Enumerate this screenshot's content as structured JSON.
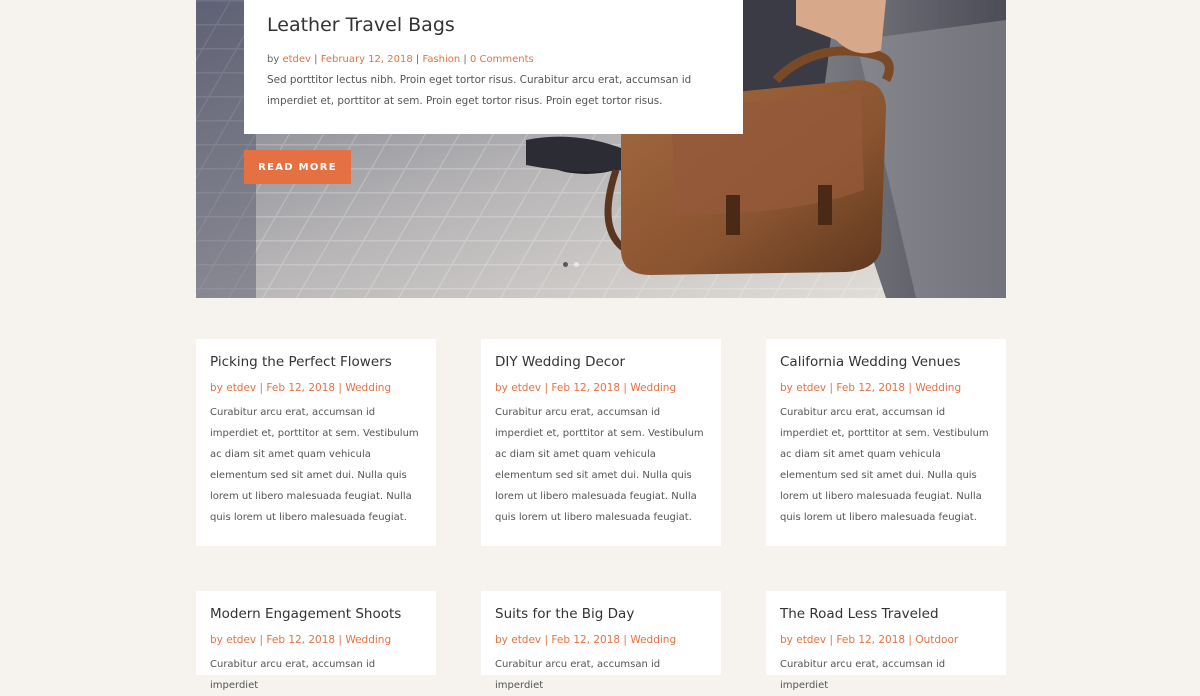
{
  "featured": {
    "title": "Leather Travel Bags",
    "meta": {
      "by": "by",
      "author": "etdev",
      "sep": "|",
      "date": "February 12, 2018",
      "category": "Fashion",
      "comments": "0 Comments"
    },
    "excerpt": "Sed porttitor lectus nibh. Proin eget tortor risus. Curabitur arcu erat, accumsan id imperdiet et, porttitor at sem. Proin eget tortor risus. Proin eget tortor risus.",
    "button_label": "READ MORE",
    "slide_count": 2,
    "active_slide": 1
  },
  "posts": [
    {
      "title": "Picking the Perfect Flowers",
      "by": "by",
      "author": "etdev",
      "sep": "|",
      "date": "Feb 12, 2018",
      "category": "Wedding",
      "excerpt": "Curabitur arcu erat, accumsan id imperdiet et, porttitor at sem. Vestibulum ac diam sit amet quam vehicula elementum sed sit amet dui. Nulla quis lorem ut libero malesuada feugiat. Nulla quis lorem ut libero malesuada feugiat."
    },
    {
      "title": "DIY Wedding Decor",
      "by": "by",
      "author": "etdev",
      "sep": "|",
      "date": "Feb 12, 2018",
      "category": "Wedding",
      "excerpt": "Curabitur arcu erat, accumsan id imperdiet et, porttitor at sem. Vestibulum ac diam sit amet quam vehicula elementum sed sit amet dui. Nulla quis lorem ut libero malesuada feugiat. Nulla quis lorem ut libero malesuada feugiat."
    },
    {
      "title": "California Wedding Venues",
      "by": "by",
      "author": "etdev",
      "sep": "|",
      "date": "Feb 12, 2018",
      "category": "Wedding",
      "excerpt": "Curabitur arcu erat, accumsan id imperdiet et, porttitor at sem. Vestibulum ac diam sit amet quam vehicula elementum sed sit amet dui. Nulla quis lorem ut libero malesuada feugiat. Nulla quis lorem ut libero malesuada feugiat."
    },
    {
      "title": "Modern Engagement Shoots",
      "by": "by",
      "author": "etdev",
      "sep": "|",
      "date": "Feb 12, 2018",
      "category": "Wedding",
      "excerpt": "Curabitur arcu erat, accumsan id imperdiet"
    },
    {
      "title": "Suits for the Big Day",
      "by": "by",
      "author": "etdev",
      "sep": "|",
      "date": "Feb 12, 2018",
      "category": "Wedding",
      "excerpt": "Curabitur arcu erat, accumsan id imperdiet"
    },
    {
      "title": "The Road Less Traveled",
      "by": "by",
      "author": "etdev",
      "sep": "|",
      "date": "Feb 12, 2018",
      "category": "Outdoor",
      "excerpt": "Curabitur arcu erat, accumsan id imperdiet"
    }
  ],
  "colors": {
    "page_background": "#f6f3ee",
    "accent": "#e57142",
    "card_background": "#ffffff",
    "title_text": "#333333",
    "body_text": "#555555"
  }
}
